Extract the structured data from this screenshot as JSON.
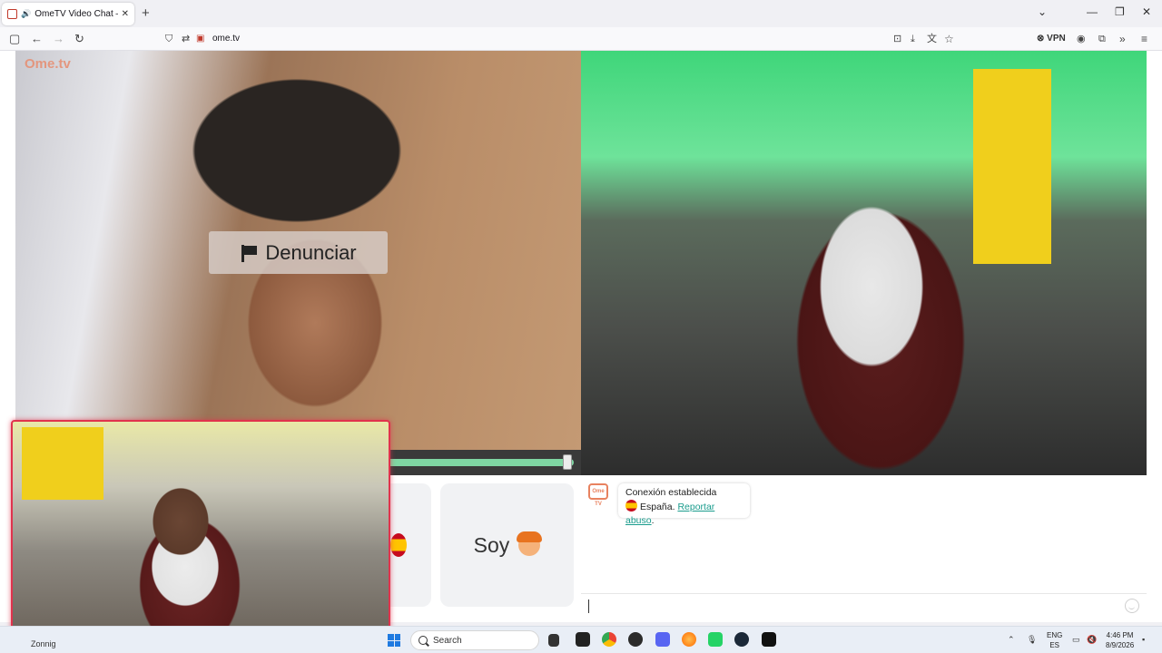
{
  "browser": {
    "tab_title": "OmeTV Video Chat — Ome",
    "tab_close": "✕",
    "new_tab": "+",
    "url": "ome.tv",
    "vpn_label": "VPN",
    "window_controls": {
      "dropdown": "⌄",
      "minimize": "—",
      "restore": "❐",
      "close": "✕"
    }
  },
  "video_left": {
    "logo": "Ome.tv",
    "report_label": "Denunciar"
  },
  "cards": {
    "soy_label": "Soy"
  },
  "chat": {
    "logo_text": "Ome TV",
    "status_title": "Conexión establecida",
    "country": "España.",
    "report_link": "Reportar abuso",
    "report_link_suffix": "."
  },
  "taskbar": {
    "weather": "Zonnig",
    "search_placeholder": "Search",
    "lang_top": "ENG",
    "lang_bottom": "ES",
    "time": "4:46 PM",
    "date": "8/9/2026"
  },
  "colors": {
    "accent_red": "#e0334d",
    "link_teal": "#1a9c8d",
    "progress_green": "#7fd6a3"
  }
}
